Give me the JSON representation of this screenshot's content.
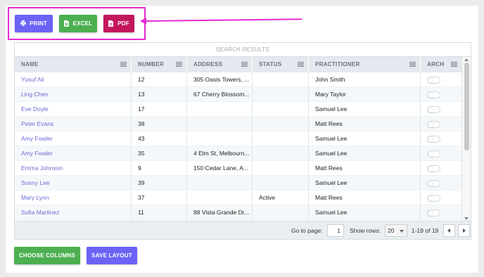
{
  "toolbar": {
    "print_label": "PRINT",
    "excel_label": "EXCEL",
    "pdf_label": "PDF"
  },
  "grid": {
    "title": "SEARCH RESULTS",
    "columns": [
      "NAME",
      "NUMBER",
      "ADDRESS",
      "STATUS",
      "PRACTITIONER",
      "ARCH"
    ],
    "rows": [
      {
        "name": "Yusuf Ali",
        "number": "12",
        "address": "305 Oasis Towers, ...",
        "status": "",
        "practitioner": "John Smith"
      },
      {
        "name": "Ling Chen",
        "number": "13",
        "address": "67 Cherry Blossom...",
        "status": "",
        "practitioner": "Mary Taylor"
      },
      {
        "name": "Eve Doyle",
        "number": "17",
        "address": "",
        "status": "",
        "practitioner": "Samuel Lee"
      },
      {
        "name": "Peter Evans",
        "number": "38",
        "address": "",
        "status": "",
        "practitioner": "Matt Rees"
      },
      {
        "name": "Amy Fowler",
        "number": "43",
        "address": "",
        "status": "",
        "practitioner": "Samuel Lee"
      },
      {
        "name": "Amy Fowler",
        "number": "35",
        "address": "4 Elm St, Melbourn...",
        "status": "",
        "practitioner": "Samuel Lee"
      },
      {
        "name": "Emma Johnson",
        "number": "9",
        "address": "150 Cedar Lane, A...",
        "status": "",
        "practitioner": "Matt Rees"
      },
      {
        "name": "Sonny Lee",
        "number": "39",
        "address": "",
        "status": "",
        "practitioner": "Samuel Lee"
      },
      {
        "name": "Mary Lynn",
        "number": "37",
        "address": "",
        "status": "Active",
        "practitioner": "Matt Rees"
      },
      {
        "name": "Sofia Martinez",
        "number": "11",
        "address": "88 Vista Grande Dr...",
        "status": "",
        "practitioner": "Samuel Lee"
      }
    ]
  },
  "pager": {
    "goto_label": "Go to page:",
    "page_value": "1",
    "show_rows_label": "Show rows:",
    "rows_value": "20",
    "range": "1-19 of 19"
  },
  "footer_buttons": {
    "choose_columns": "CHOOSE COLUMNS",
    "save_layout": "SAVE LAYOUT"
  },
  "colors": {
    "print": "#6c63f5",
    "excel": "#4caf50",
    "pdf": "#c2185b",
    "annotation": "#e62ad2",
    "link": "#6b6bd6"
  }
}
